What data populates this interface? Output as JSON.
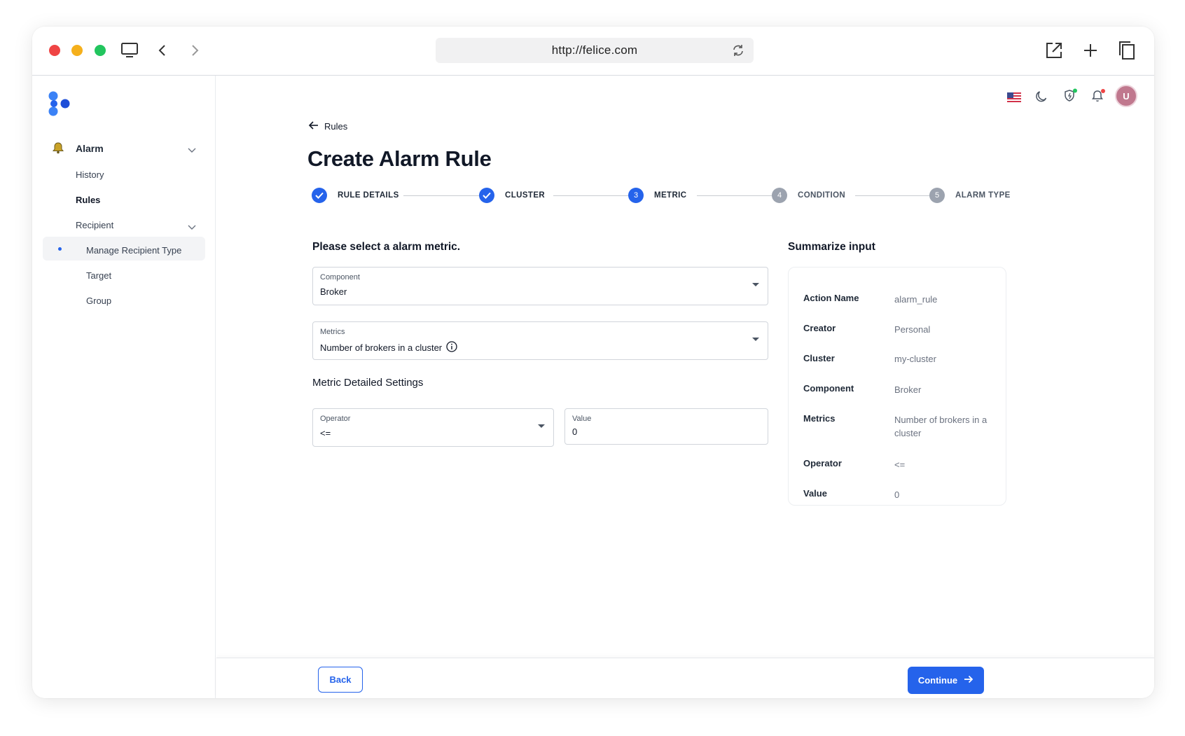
{
  "browser": {
    "url": "http://felice.com"
  },
  "sidebar": {
    "alarm_label": "Alarm",
    "items": [
      {
        "label": "History"
      },
      {
        "label": "Rules"
      },
      {
        "label": "Recipient"
      },
      {
        "label": "Manage Recipient Type"
      },
      {
        "label": "Target"
      },
      {
        "label": "Group"
      }
    ]
  },
  "header": {
    "avatar_initial": "U",
    "accent_color": "#2563eb"
  },
  "page": {
    "back_label": "Rules",
    "title": "Create Alarm Rule"
  },
  "stepper": {
    "steps": [
      {
        "number": "1",
        "label": "RULE DETAILS",
        "state": "done"
      },
      {
        "number": "2",
        "label": "CLUSTER",
        "state": "done"
      },
      {
        "number": "3",
        "label": "METRIC",
        "state": "active"
      },
      {
        "number": "4",
        "label": "CONDITION",
        "state": "todo"
      },
      {
        "number": "5",
        "label": "ALARM TYPE",
        "state": "todo"
      }
    ]
  },
  "form": {
    "heading": "Please select a alarm metric.",
    "component": {
      "label": "Component",
      "value": "Broker"
    },
    "metrics": {
      "label": "Metrics",
      "value": "Number of brokers in a cluster"
    },
    "detail_heading": "Metric Detailed Settings",
    "operator": {
      "label": "Operator",
      "value": "<="
    },
    "value": {
      "label": "Value",
      "value": "0"
    }
  },
  "summary": {
    "heading": "Summarize input",
    "rows": [
      {
        "key": "Action Name",
        "value": "alarm_rule"
      },
      {
        "key": "Creator",
        "value": "Personal"
      },
      {
        "key": "Cluster",
        "value": "my-cluster"
      },
      {
        "key": "Component",
        "value": "Broker"
      },
      {
        "key": "Metrics",
        "value": "Number of brokers in a cluster"
      },
      {
        "key": "Operator",
        "value": "<="
      },
      {
        "key": "Value",
        "value": "0"
      }
    ]
  },
  "footer": {
    "back_label": "Back",
    "continue_label": "Continue"
  }
}
